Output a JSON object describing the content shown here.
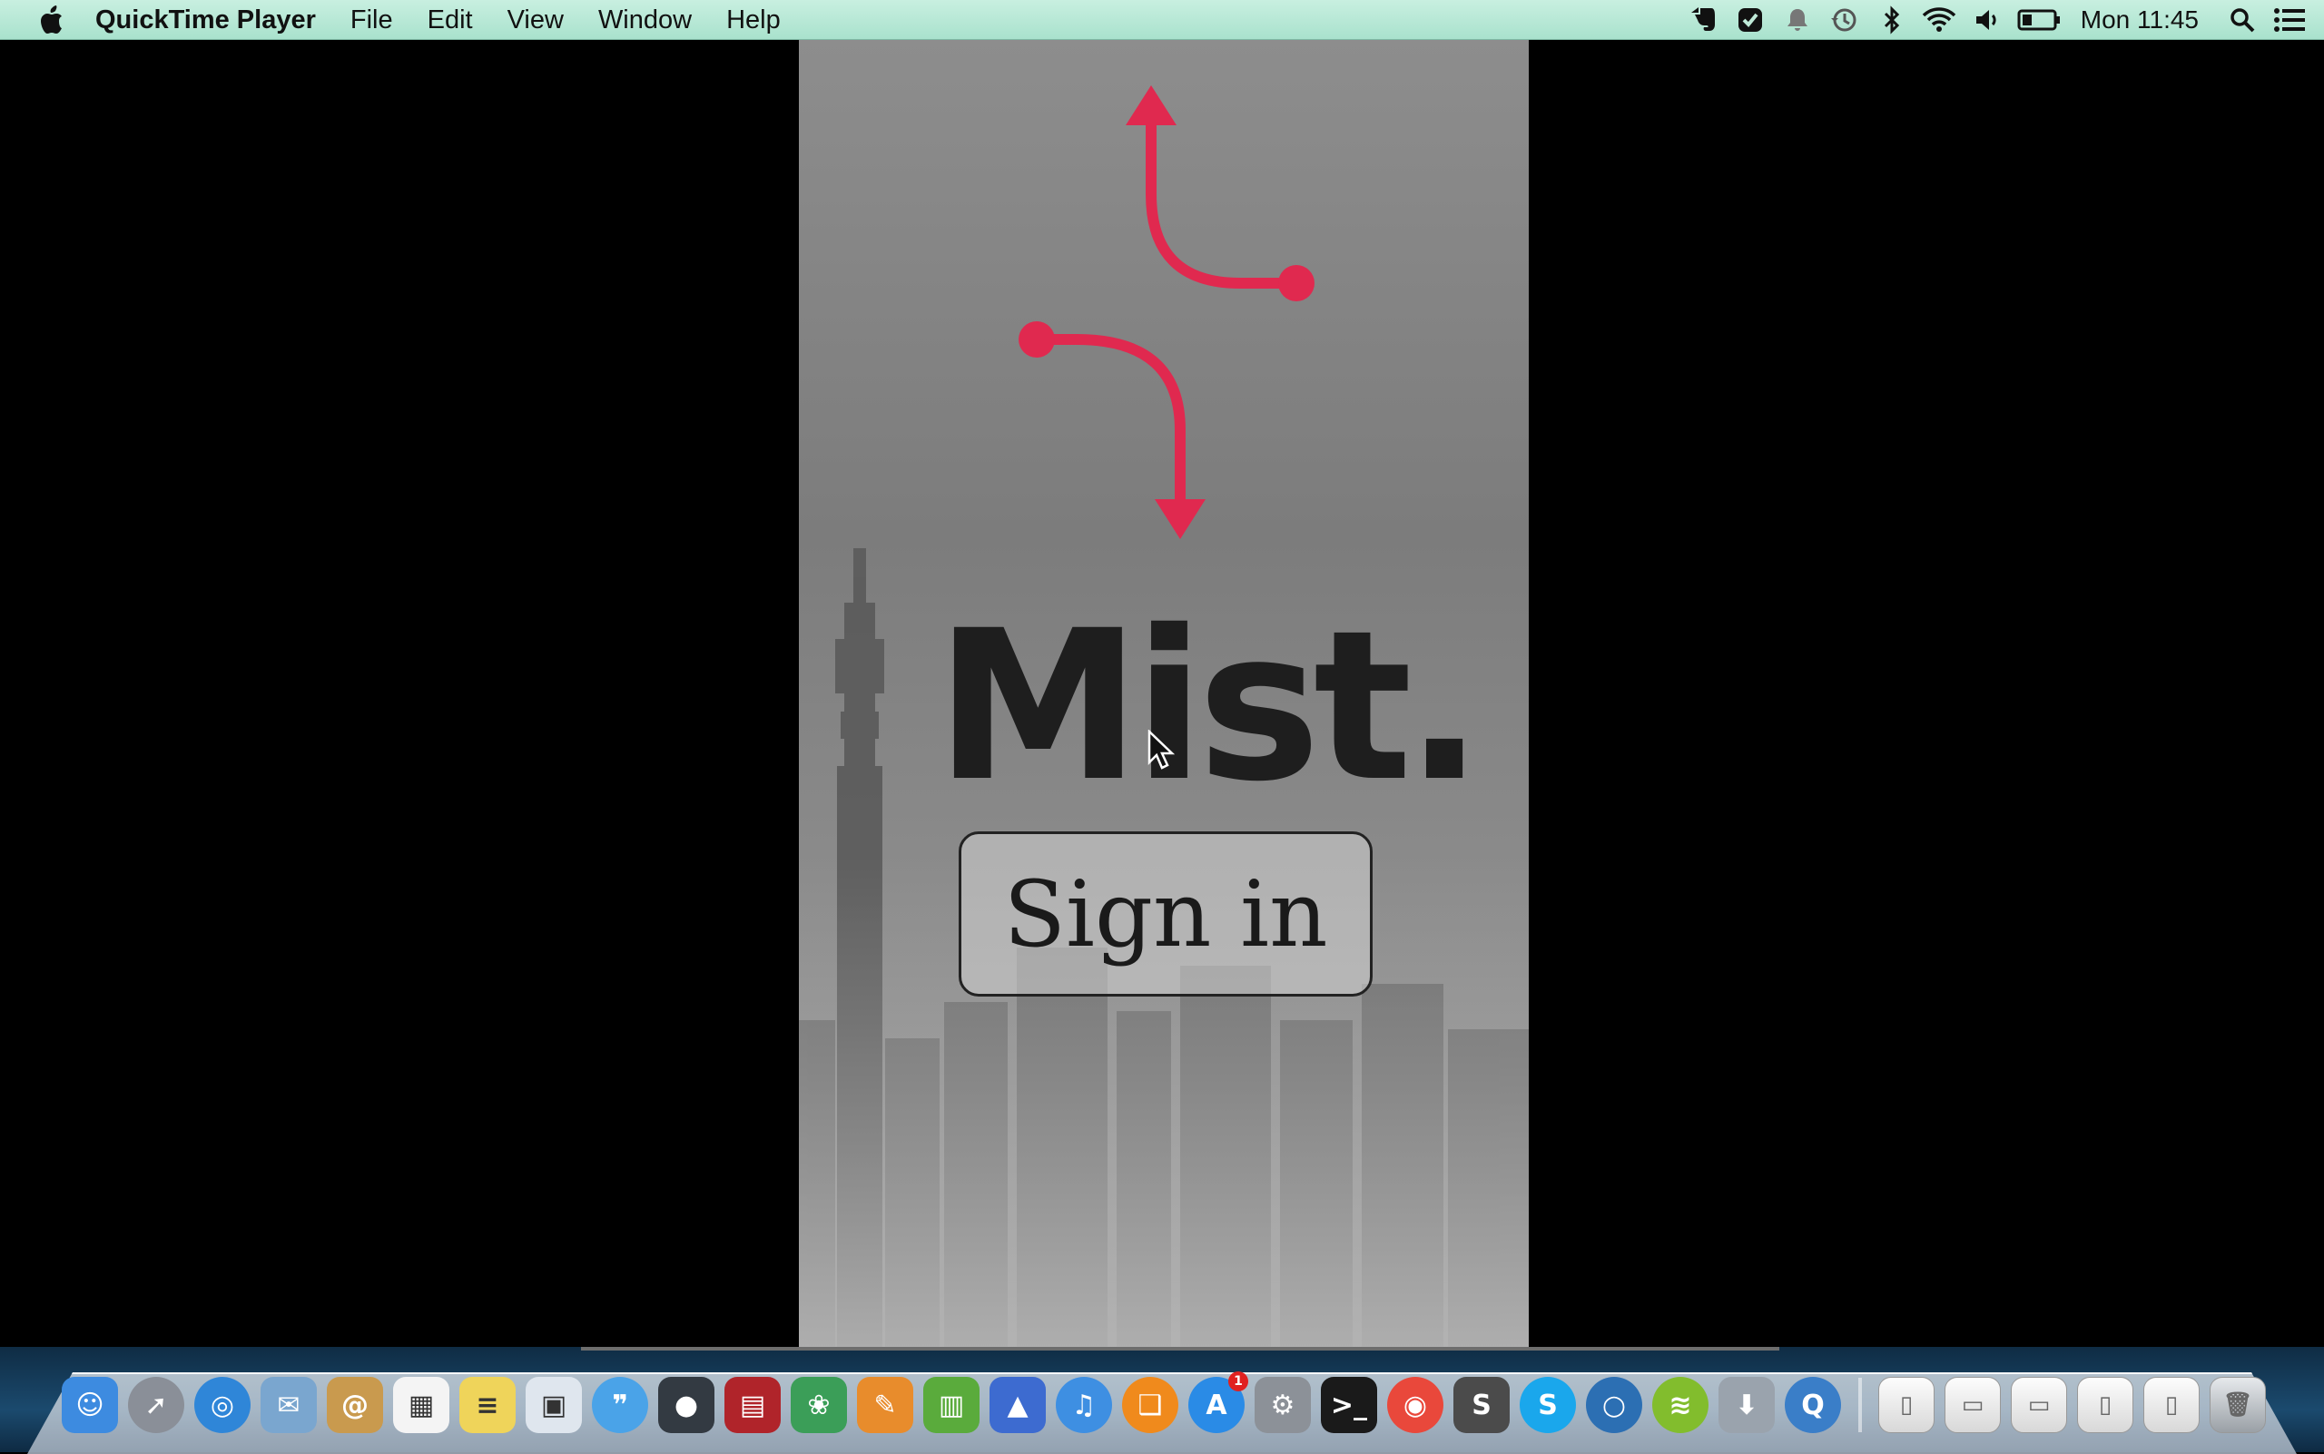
{
  "menubar": {
    "app_name": "QuickTime Player",
    "menus": [
      "File",
      "Edit",
      "View",
      "Window",
      "Help"
    ],
    "clock": "Mon 11:45",
    "status_icons": [
      "evernote-icon",
      "task-check-icon",
      "notification-bell-icon",
      "time-machine-icon",
      "bluetooth-icon",
      "wifi-icon",
      "volume-icon",
      "battery-icon",
      "spotlight-search-icon",
      "notification-center-icon"
    ]
  },
  "video": {
    "logo_text": "Mist.",
    "button_label": "Sign in",
    "accent_color": "#e0294f"
  },
  "dock": {
    "apps": [
      {
        "name": "finder-icon",
        "color": "#3d8be0"
      },
      {
        "name": "launchpad-icon",
        "color": "#8a8f98"
      },
      {
        "name": "safari-icon",
        "color": "#2f86d8"
      },
      {
        "name": "mail-icon",
        "color": "#7aa6cf"
      },
      {
        "name": "contacts-icon",
        "color": "#c99a4e"
      },
      {
        "name": "calendar-icon",
        "color": "#f4f4f4"
      },
      {
        "name": "notes-icon",
        "color": "#efd45a"
      },
      {
        "name": "preview-icon",
        "color": "#dfe6ee"
      },
      {
        "name": "messages-icon",
        "color": "#4aa3e8"
      },
      {
        "name": "facetime-icon",
        "color": "#333a42"
      },
      {
        "name": "photo-booth-icon",
        "color": "#b0242a"
      },
      {
        "name": "iphoto-icon",
        "color": "#3b9e58"
      },
      {
        "name": "pages-icon",
        "color": "#e88c2c"
      },
      {
        "name": "numbers-icon",
        "color": "#5aab3c"
      },
      {
        "name": "keynote-icon",
        "color": "#3d6bd0"
      },
      {
        "name": "itunes-icon",
        "color": "#3e8fe2"
      },
      {
        "name": "ibooks-icon",
        "color": "#f08a1c"
      },
      {
        "name": "app-store-icon",
        "color": "#2a8be6",
        "badge": "1"
      },
      {
        "name": "system-preferences-icon",
        "color": "#8c9198"
      },
      {
        "name": "terminal-icon",
        "color": "#1a1a1a"
      },
      {
        "name": "chrome-icon",
        "color": "#e9483b"
      },
      {
        "name": "sublime-text-icon",
        "color": "#4b4b4b"
      },
      {
        "name": "skype-icon",
        "color": "#1aa7ec"
      },
      {
        "name": "chat-icon",
        "color": "#2c6fb3"
      },
      {
        "name": "spotify-icon",
        "color": "#82bd2d"
      },
      {
        "name": "downloads-icon",
        "color": "#9aa3ad"
      },
      {
        "name": "quicktime-icon",
        "color": "#3a7ec8"
      }
    ],
    "stacks": [
      "document-stack-icon",
      "folder-stack-icon",
      "folder-stack-icon",
      "document-stack-icon",
      "document-stack-icon",
      "trash-icon"
    ]
  }
}
